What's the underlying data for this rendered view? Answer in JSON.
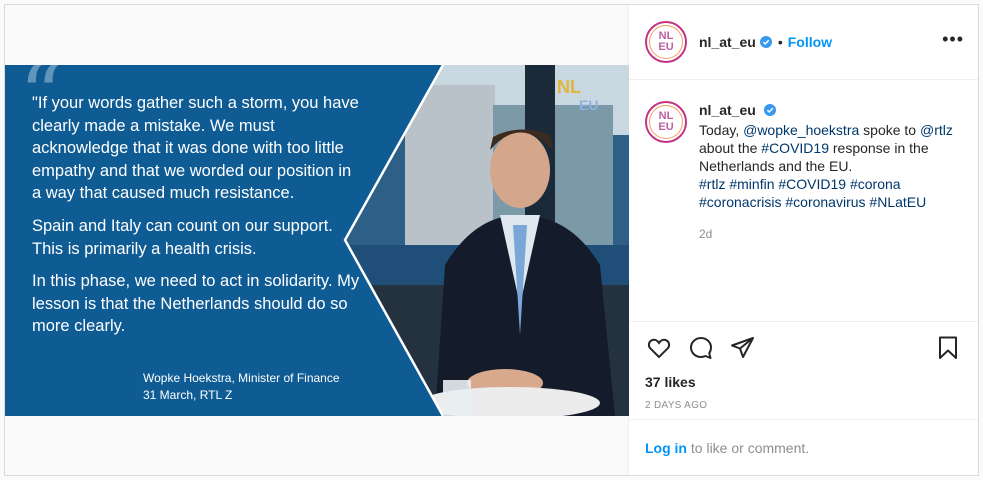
{
  "post": {
    "quote": {
      "paragraph1": "\"If your words gather such a storm, you have clearly made a mistake. We must acknowledge that it was done with too little empathy and that we worded our position in a way that caused much resistance.",
      "paragraph2": "Spain and Italy can count on our support. This is primarily a health crisis.",
      "paragraph3": "In this phase, we need to act in solidarity. My lesson is that the Netherlands should do so more clearly.",
      "attribution_line1": "Wopke Hoekstra, Minister of Finance",
      "attribution_line2": "31 March, RTL Z"
    },
    "watermark": {
      "line1": "NL",
      "line2": "EU"
    }
  },
  "header": {
    "avatar_text_top": "NL",
    "avatar_text_bottom": "EU",
    "username": "nl_at_eu",
    "separator": "•",
    "follow_label": "Follow",
    "more_label": "•••"
  },
  "comment": {
    "username": "nl_at_eu",
    "caption_parts": [
      {
        "type": "text",
        "value": "Today, "
      },
      {
        "type": "mention",
        "value": "@wopke_hoekstra"
      },
      {
        "type": "text",
        "value": " spoke to "
      },
      {
        "type": "mention",
        "value": "@rtlz"
      },
      {
        "type": "text",
        "value": " about the "
      },
      {
        "type": "tag",
        "value": "#COVID19"
      },
      {
        "type": "text",
        "value": " response in the Netherlands and the EU."
      }
    ],
    "hashtags": [
      "#rtlz",
      "#minfin",
      "#COVID19",
      "#corona",
      "#coronacrisis",
      "#coronavirus",
      "#NLatEU"
    ],
    "time": "2d"
  },
  "actions": {
    "icons": [
      "heart-icon",
      "comment-icon",
      "share-icon",
      "bookmark-icon"
    ],
    "likes": "37 likes",
    "date": "2 DAYS AGO"
  },
  "login": {
    "link_label": "Log in",
    "rest": " to like or comment."
  },
  "colors": {
    "quote_bg": "#0f5c95",
    "link": "#0095f6",
    "tag": "#00376b",
    "muted": "#8e8e8e"
  }
}
